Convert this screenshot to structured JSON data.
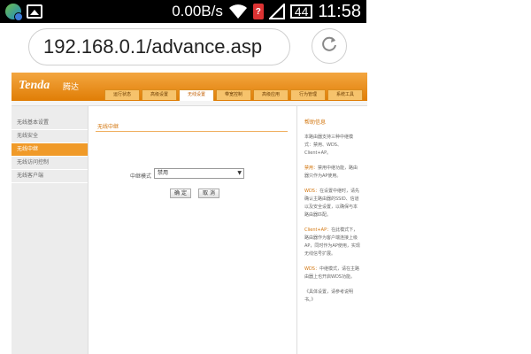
{
  "status_bar": {
    "speed": "0.00B/s",
    "battery": "44",
    "time": "11:58"
  },
  "browser": {
    "url": "192.168.0.1/advance.asp"
  },
  "router": {
    "logo": "Tenda",
    "logo_cn": "腾达",
    "tabs": [
      "运行状态",
      "高级设置",
      "无线设置",
      "带宽控制",
      "高级应用",
      "行为管理",
      "系统工具"
    ],
    "active_tab": 2,
    "sidebar": [
      "无线基本设置",
      "无线安全",
      "无线中继",
      "无线访问控制",
      "无线客户端"
    ],
    "active_sidebar": 2,
    "section_title": "无线中继",
    "form_label": "中继模式",
    "select_value": "禁用",
    "confirm_label": "确 定",
    "cancel_label": "取 消",
    "help": {
      "title": "帮助信息",
      "intro": "本路由器支持三种中继模式：禁用、WDS、Client+AP。",
      "p1_title": "禁用：",
      "p1": "禁用中继功能，路由器只作为AP使用。",
      "p2_title": "WDS：",
      "p2": "在设置中继时，请先确认主路由器的SSID、信道以及安全设置，以确保与本路由器匹配。",
      "p3_title": "Client+AP：",
      "p3": "在此模式下，路由器作为客户端连接上级AP，同时作为AP使用，实现无线信号扩展。",
      "p4_title": "WDS：",
      "p4": "中继模式，请在主路由器上也开启WDS功能。",
      "p5": "《具体设置，请参考说明书。》"
    }
  }
}
